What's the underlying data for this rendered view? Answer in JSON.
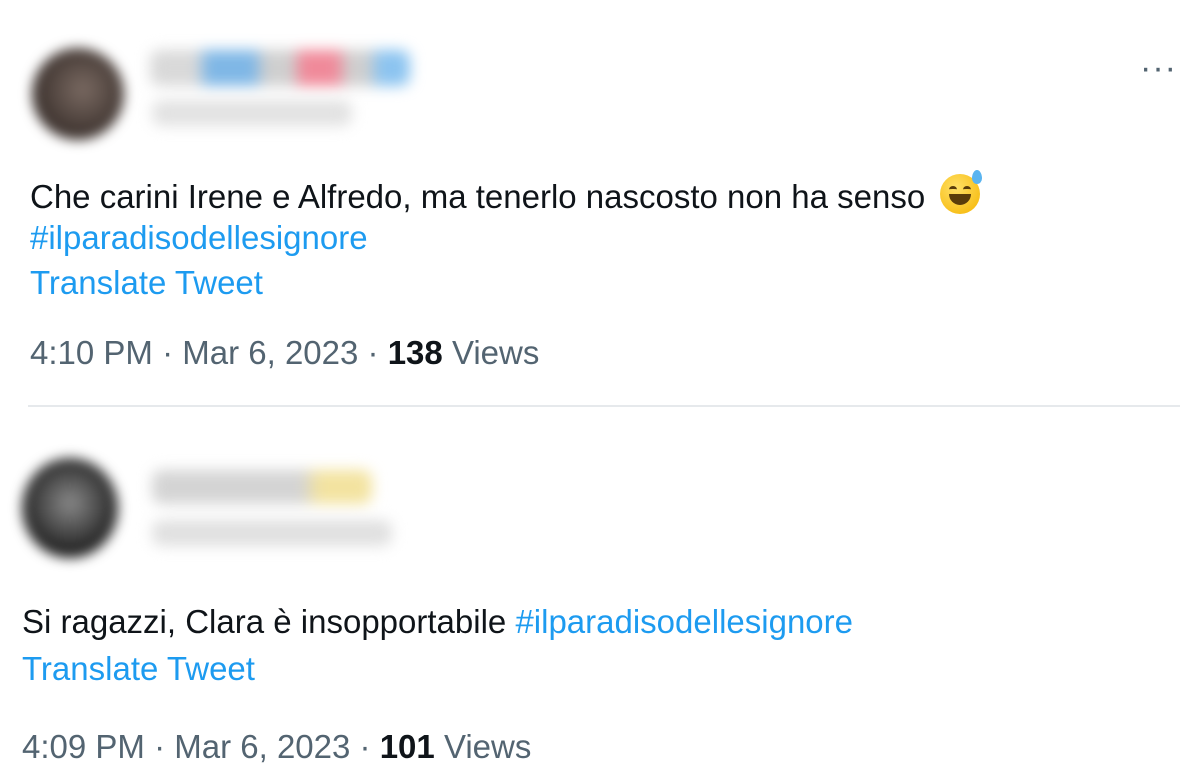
{
  "tweets": [
    {
      "text": "Che carini Irene e Alfredo, ma tenerlo nascosto non ha senso",
      "hashtag": "#ilparadisodellesignore",
      "translate_label": "Translate Tweet",
      "time": "4:10 PM",
      "date": "Mar 6, 2023",
      "views_count": "138",
      "views_label": "Views",
      "more_label": "···",
      "emoji": "grinning-face-with-sweat-icon"
    },
    {
      "text": "Si ragazzi, Clara è insopportabile",
      "hashtag": "#ilparadisodellesignore",
      "translate_label": "Translate Tweet",
      "time": "4:09 PM",
      "date": "Mar 6, 2023",
      "views_count": "101",
      "views_label": "Views"
    }
  ],
  "separator": "·",
  "colors": {
    "link": "#1d9bf0",
    "meta": "#536471",
    "text": "#0f1419"
  }
}
